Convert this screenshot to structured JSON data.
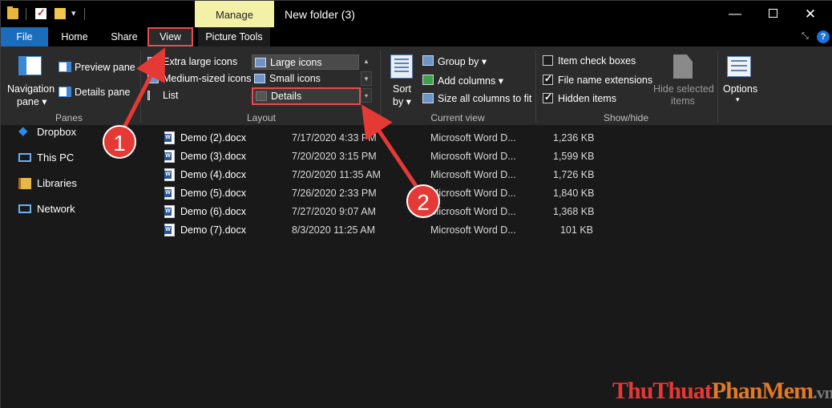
{
  "quick_access": {
    "dropdown_glyph": "▾"
  },
  "titlebar": {
    "manage_label": "Manage",
    "title": "New folder (3)",
    "minimize_glyph": "—",
    "close_glyph": "✕"
  },
  "tabs": {
    "file": "File",
    "home": "Home",
    "share": "Share",
    "view": "View",
    "picture_tools": "Picture Tools",
    "pin_glyph": "⤡",
    "help_glyph": "?"
  },
  "ribbon": {
    "panes": {
      "label": "Panes",
      "navigation_pane": "Navigation",
      "navigation_pane_2": "pane ▾",
      "preview_pane": "Preview pane",
      "details_pane": "Details pane"
    },
    "layout": {
      "label": "Layout",
      "extra_large_icons": "Extra large icons",
      "large_icons": "Large icons",
      "medium_icons": "Medium-sized icons",
      "small_icons": "Small icons",
      "list": "List",
      "details": "Details",
      "scroll_up": "▲",
      "scroll_down": "▼",
      "more": "▾"
    },
    "current_view": {
      "label": "Current view",
      "sort_by": "Sort",
      "sort_by_2": "by ▾",
      "group_by": "Group by ▾",
      "add_columns": "Add columns ▾",
      "size_columns": "Size all columns to fit"
    },
    "show_hide": {
      "label": "Show/hide",
      "item_check_boxes": "Item check boxes",
      "item_check_boxes_checked": false,
      "file_name_extensions": "File name extensions",
      "file_name_extensions_checked": true,
      "hidden_items": "Hidden items",
      "hidden_items_checked": true,
      "hide_selected": "Hide selected",
      "hide_selected_2": "items"
    },
    "options": {
      "label": "Options",
      "arrow": "▾"
    }
  },
  "nav": {
    "items": [
      "Dropbox",
      "This PC",
      "Libraries",
      "Network"
    ]
  },
  "files": [
    {
      "name": "Demo (2).docx",
      "date": "7/17/2020 4:33 PM",
      "type": "Microsoft Word D...",
      "size": "1,236 KB"
    },
    {
      "name": "Demo (3).docx",
      "date": "7/20/2020 3:15 PM",
      "type": "Microsoft Word D...",
      "size": "1,599 KB"
    },
    {
      "name": "Demo (4).docx",
      "date": "7/20/2020 11:35 AM",
      "type": "Microsoft Word D...",
      "size": "1,726 KB"
    },
    {
      "name": "Demo (5).docx",
      "date": "7/26/2020 2:33 PM",
      "type": "Microsoft Word D...",
      "size": "1,840 KB"
    },
    {
      "name": "Demo (6).docx",
      "date": "7/27/2020 9:07 AM",
      "type": "Microsoft Word D...",
      "size": "1,368 KB"
    },
    {
      "name": "Demo (7).docx",
      "date": "8/3/2020 11:25 AM",
      "type": "Microsoft Word D...",
      "size": "101 KB"
    }
  ],
  "annotations": {
    "step1": "1",
    "step2": "2",
    "arrow_color": "#e53935"
  },
  "watermark": {
    "part1": "ThuThuat",
    "part2": "PhanMem",
    "part3": ".vn"
  }
}
